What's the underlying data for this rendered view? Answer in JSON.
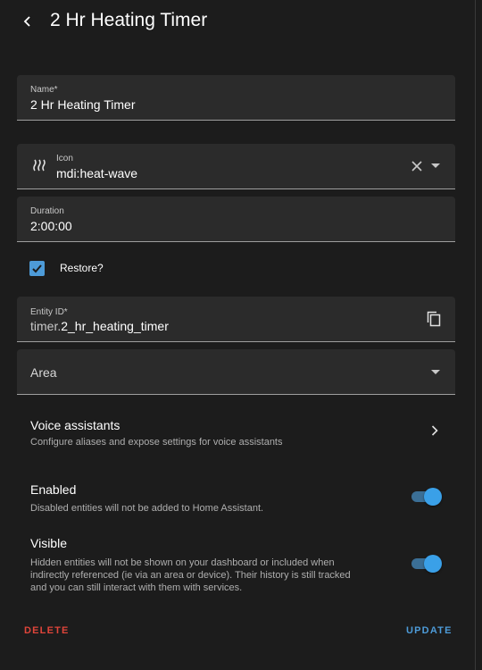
{
  "header": {
    "title": "2 Hr Heating Timer"
  },
  "name_field": {
    "label": "Name*",
    "value": "2 Hr Heating Timer"
  },
  "icon_field": {
    "label": "Icon",
    "value": "mdi:heat-wave",
    "icon": "heat-wave-icon"
  },
  "duration_field": {
    "label": "Duration",
    "value": "2:00:00"
  },
  "restore": {
    "label": "Restore?",
    "checked": true
  },
  "entity_id_field": {
    "label": "Entity ID*",
    "prefix": "timer.",
    "value": "2_hr_heating_timer"
  },
  "area_field": {
    "label": "Area"
  },
  "voice": {
    "title": "Voice assistants",
    "description": "Configure aliases and expose settings for voice assistants"
  },
  "enabled": {
    "title": "Enabled",
    "description": "Disabled entities will not be added to Home Assistant.",
    "on": true
  },
  "visible": {
    "title": "Visible",
    "description_lines": [
      "Hidden entities will not be shown on your dashboard or included when",
      "indirectly referenced (ie via an area or device). Their history is still tracked",
      "and you can still interact with them with services."
    ],
    "on": true
  },
  "actions": {
    "delete_label": "DELETE",
    "update_label": "UPDATE"
  },
  "colors": {
    "accent": "#3aa0e8",
    "danger": "#e0453a",
    "update": "#4d9bd8"
  }
}
